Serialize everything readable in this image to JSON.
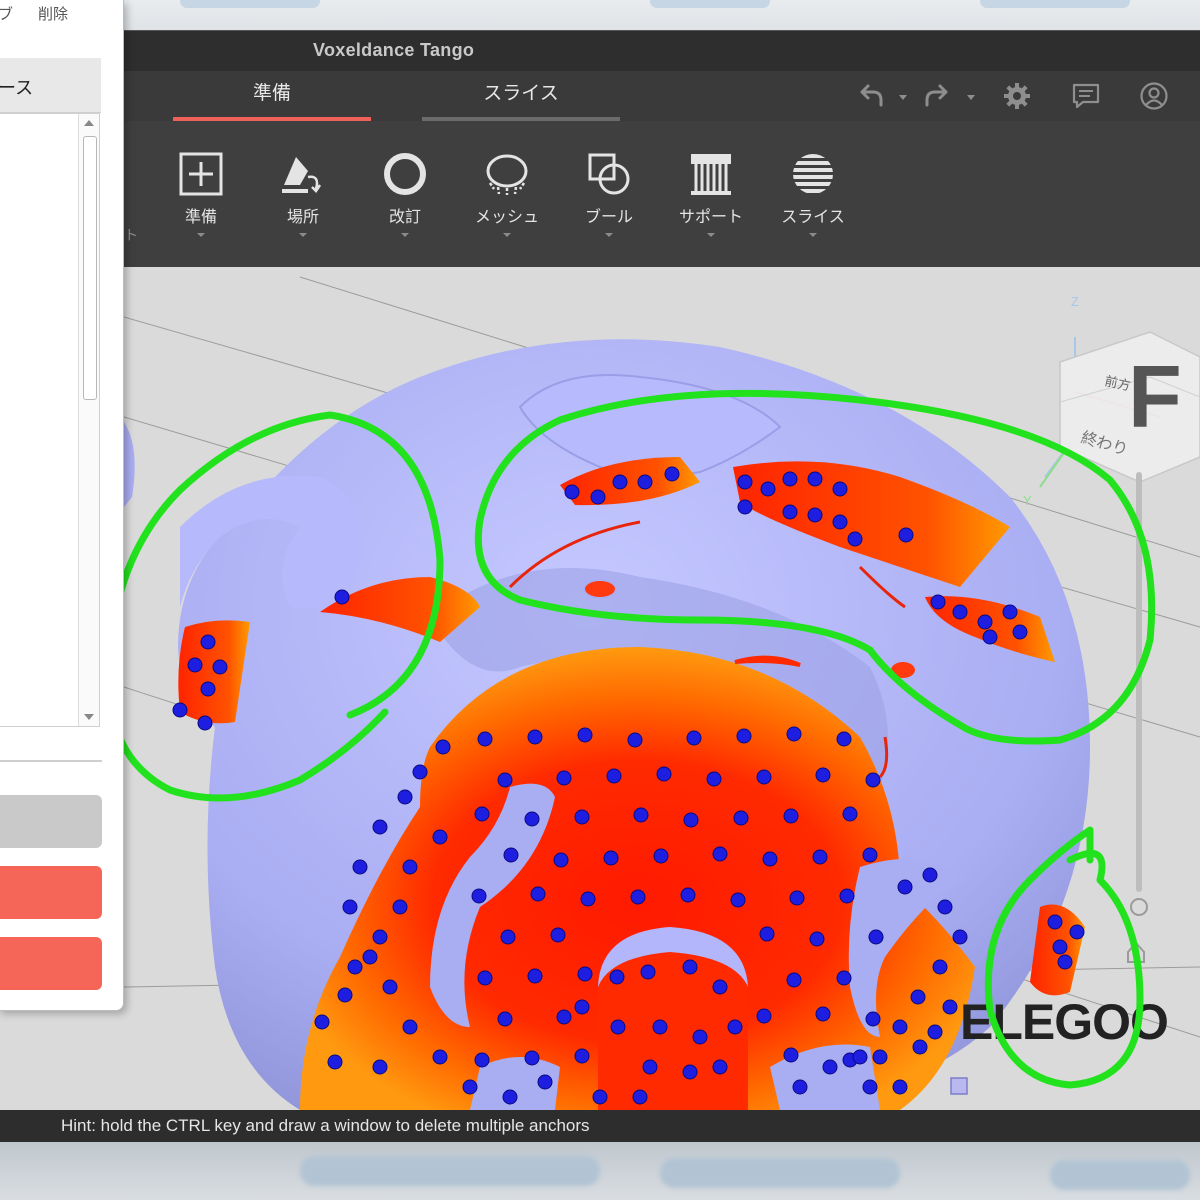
{
  "window": {
    "title": "Voxeldance Tango"
  },
  "tabs": [
    {
      "label": "準備",
      "active": true
    },
    {
      "label": "スライス",
      "active": false
    }
  ],
  "toolbar": {
    "ghost_text": "ト",
    "tools": [
      {
        "label": "準備",
        "icon": "add-box-icon"
      },
      {
        "label": "場所",
        "icon": "place-icon"
      },
      {
        "label": "改訂",
        "icon": "ring-icon"
      },
      {
        "label": "メッシュ",
        "icon": "mesh-icon"
      },
      {
        "label": "ブール",
        "icon": "boolean-icon"
      },
      {
        "label": "サポート",
        "icon": "support-icon"
      },
      {
        "label": "スライス",
        "icon": "slice-icon"
      }
    ]
  },
  "left_panel": {
    "top_left_text": "ブ",
    "top_right_text": "削除",
    "list_header": "ース"
  },
  "viewcube": {
    "axis_z": "Z",
    "axis_y": "Y",
    "face_front": "前方",
    "face_end": "終わり",
    "letter": "F"
  },
  "brand": {
    "watermark": "ELEGOO"
  },
  "hint": {
    "text": "Hint: hold the CTRL key and draw a window to delete multiple anchors"
  },
  "colors": {
    "model": "#a9adf2",
    "overhang_red": "#ff1a00",
    "overhang_orange": "#ff8a00",
    "anchor": "#1e1ee0",
    "annotation": "#22e21e",
    "accent": "#f0605a"
  }
}
